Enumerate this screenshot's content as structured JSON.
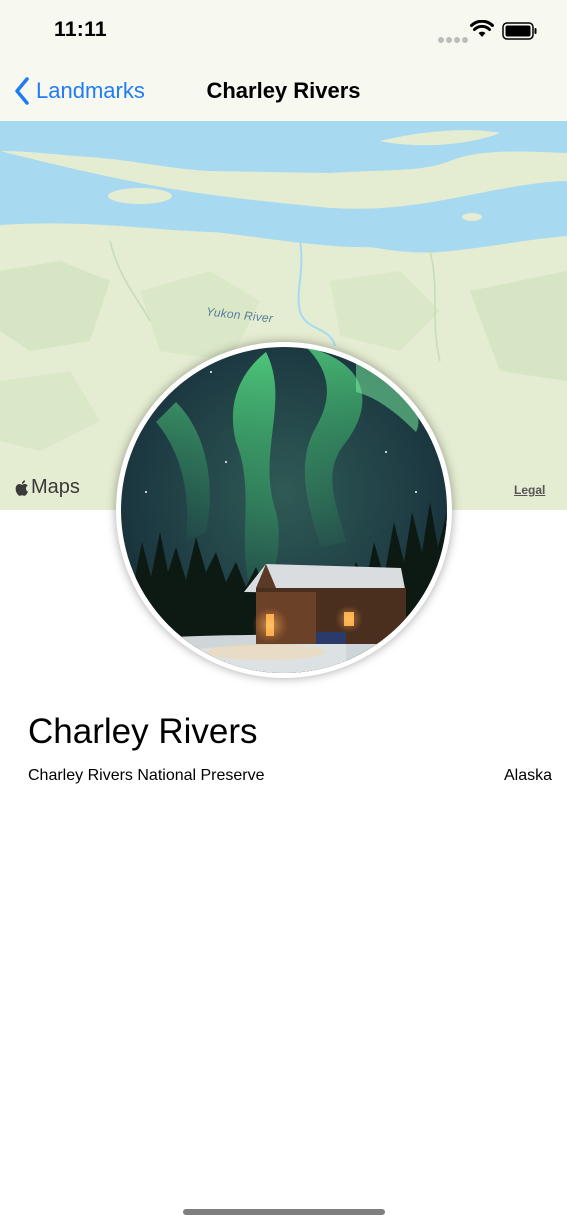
{
  "status_bar": {
    "time": "11:11"
  },
  "nav": {
    "back_label": "Landmarks",
    "title": "Charley Rivers"
  },
  "map": {
    "river_label": "Yukon River",
    "logo_text": "Maps",
    "legal_text": "Legal"
  },
  "detail": {
    "name": "Charley Rivers",
    "park": "Charley Rivers National Preserve",
    "state": "Alaska"
  },
  "colors": {
    "accent": "#1f7cf5",
    "water": "#a7daf0",
    "land": "#e4ecd1"
  }
}
